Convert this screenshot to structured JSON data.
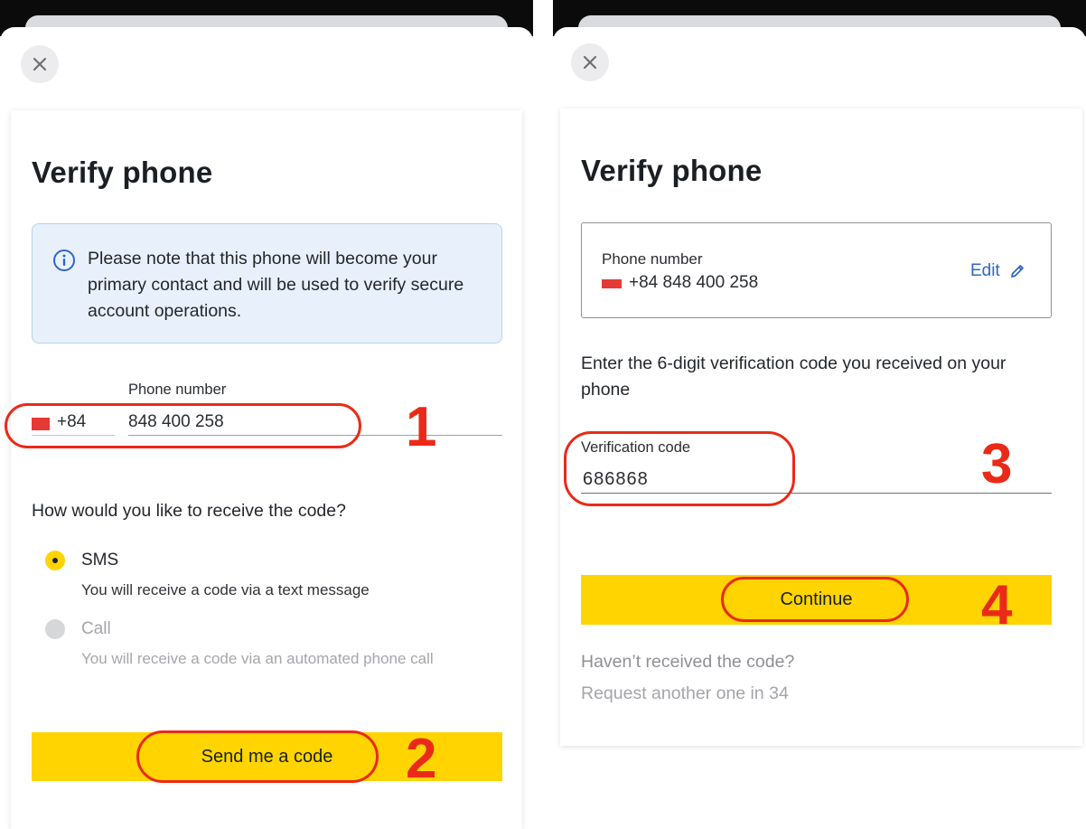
{
  "left": {
    "title": "Verify phone",
    "notice": "Please note that this phone will become your primary contact and will be used to verify secure account operations.",
    "phone_label": "Phone number",
    "country_code": "+84",
    "phone_value": "848 400 258",
    "question": "How would you like to receive the code?",
    "options": [
      {
        "label": "SMS",
        "description": "You will receive a code via a text message",
        "selected": true
      },
      {
        "label": "Call",
        "description": "You will receive a code via an automated phone call",
        "selected": false
      }
    ],
    "send_button": "Send me a code"
  },
  "right": {
    "title": "Verify phone",
    "phone_label": "Phone number",
    "phone_value": "+84 848 400 258",
    "edit_label": "Edit",
    "instruction": "Enter the 6-digit verification code you received on your phone",
    "code_label": "Verification code",
    "code_value": "686868",
    "continue_button": "Continue",
    "help_question": "Haven’t received the code?",
    "help_resend": "Request another one in 34"
  },
  "annotations": {
    "step_1": "1",
    "step_2": "2",
    "step_3": "3",
    "step_4": "4"
  },
  "colors": {
    "accent_yellow": "#ffd400",
    "annotation_red": "#ea2a18",
    "link_blue": "#2f67c3",
    "notice_bg": "#e8f1fb"
  },
  "icons": [
    "close-icon",
    "info-icon",
    "edit-pencil-icon",
    "flag-icon"
  ]
}
